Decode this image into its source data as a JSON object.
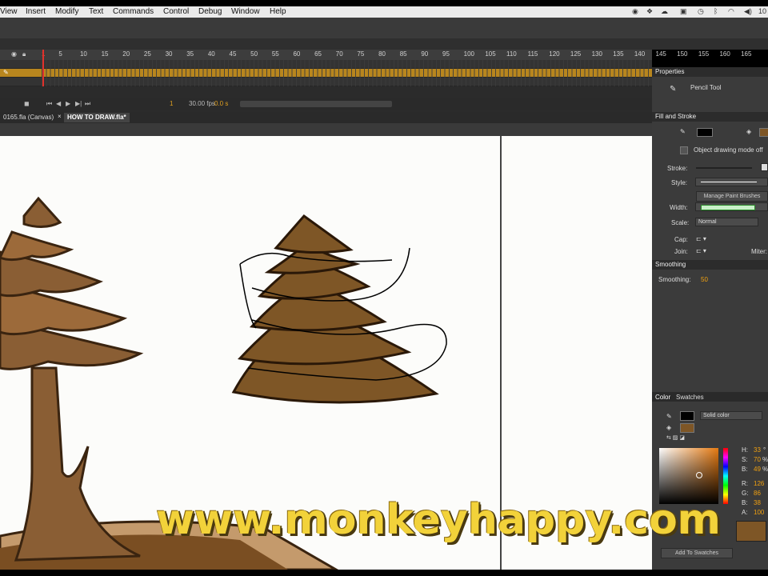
{
  "menubar": {
    "items": [
      "View",
      "Insert",
      "Modify",
      "Text",
      "Commands",
      "Control",
      "Debug",
      "Window",
      "Help"
    ],
    "clock_fragment": "10"
  },
  "timeline": {
    "frame_numbers": [
      "1",
      "5",
      "10",
      "15",
      "20",
      "25",
      "30",
      "35",
      "40",
      "45",
      "50",
      "55",
      "60",
      "65",
      "70",
      "75",
      "80",
      "85",
      "90",
      "95",
      "100",
      "105",
      "110",
      "115",
      "120",
      "125",
      "130",
      "135",
      "140",
      "145",
      "150",
      "155",
      "160",
      "165"
    ],
    "current_frame": "1",
    "fps": "30.00 fps",
    "time": "0.0 s"
  },
  "doc_tabs": [
    {
      "label": "0165.fla (Canvas)"
    },
    {
      "label": "HOW TO DRAW.fla*"
    }
  ],
  "properties": {
    "panel_title": "Properties",
    "tool_name": "Pencil Tool",
    "section_fill_stroke": "Fill and Stroke",
    "object_drawing": "Object drawing mode off",
    "stroke_label": "Stroke:",
    "style_label": "Style:",
    "manage_brushes": "Manage Paint Brushes",
    "width_label": "Width:",
    "scale_label": "Scale:",
    "scale_value": "Normal",
    "cap_label": "Cap:",
    "join_label": "Join:",
    "miter_label": "Miter:",
    "section_smoothing": "Smoothing",
    "smoothing_label": "Smoothing:",
    "smoothing_value": "50"
  },
  "color_panel": {
    "tab_color": "Color",
    "tab_swatches": "Swatches",
    "fill_type": "Solid color",
    "h_label": "H:",
    "h_value": "33",
    "s_label": "S:",
    "s_value": "70",
    "b_label": "B:",
    "b_value": "49",
    "r_label": "R:",
    "r_value": "126",
    "g_label": "G:",
    "g_value": "86",
    "bl_label": "B:",
    "bl_value": "38",
    "a_label": "A:",
    "a_value": "100",
    "degree": "°",
    "percent": "%",
    "add_swatch": "Add To Swatches",
    "fill_color": "#7e5626",
    "stroke_color": "#000000"
  },
  "watermark": "www.monkeyhappy.com"
}
